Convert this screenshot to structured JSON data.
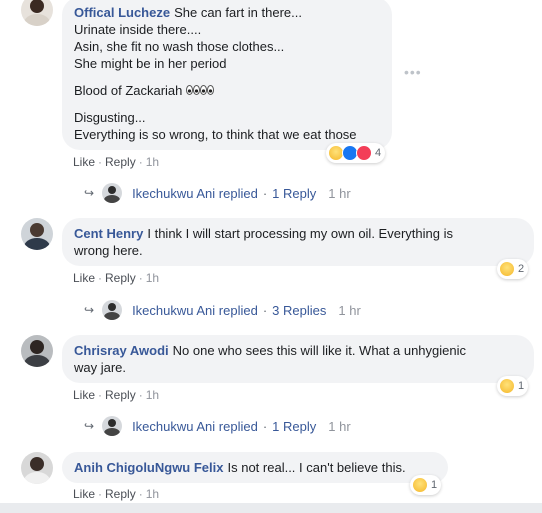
{
  "comments": [
    {
      "author": "Offical Lucheze",
      "lines": [
        "She can fart in there...",
        "Urinate inside there....",
        "Asin, she fit no wash those clothes...",
        "She might be in her period"
      ],
      "line2": "Blood of Zackariah",
      "lines3": [
        "Disgusting...",
        "Everything is so wrong, to think that we eat those"
      ],
      "reaction_count": "4",
      "actions": {
        "like": "Like",
        "reply": "Reply",
        "time": "1h"
      },
      "reply": {
        "name": "Ikechukwu Ani",
        "replied": "replied",
        "count": "1 Reply",
        "time": "1 hr"
      }
    },
    {
      "author": "Cent Henry",
      "text1": "I think I will start processing my own oil. Everything is",
      "text2": "wrong here.",
      "reaction_count": "2",
      "actions": {
        "like": "Like",
        "reply": "Reply",
        "time": "1h"
      },
      "reply": {
        "name": "Ikechukwu Ani",
        "replied": "replied",
        "count": "3 Replies",
        "time": "1 hr"
      }
    },
    {
      "author": "Chrisray Awodi",
      "text1": "No one who sees this will like it. What a unhygienic",
      "text2": "way jare.",
      "reaction_count": "1",
      "actions": {
        "like": "Like",
        "reply": "Reply",
        "time": "1h"
      },
      "reply": {
        "name": "Ikechukwu Ani",
        "replied": "replied",
        "count": "1 Reply",
        "time": "1 hr"
      }
    },
    {
      "author": "Anih ChigoluNgwu Felix",
      "text1": "Is not real... I can't believe this.",
      "reaction_count": "1",
      "actions": {
        "like": "Like",
        "reply": "Reply",
        "time": "1h"
      }
    }
  ],
  "icons": {
    "more": "more-options-icon",
    "reply_arrow": "reply-arrow-icon",
    "sad": "sad-reaction-icon",
    "like": "like-reaction-icon",
    "love": "love-reaction-icon",
    "haha": "haha-reaction-icon",
    "eyes": "eyes-emoji-icon"
  },
  "colors": {
    "author": "#385898",
    "bubble": "#f2f3f5",
    "meta": "#90949c"
  }
}
